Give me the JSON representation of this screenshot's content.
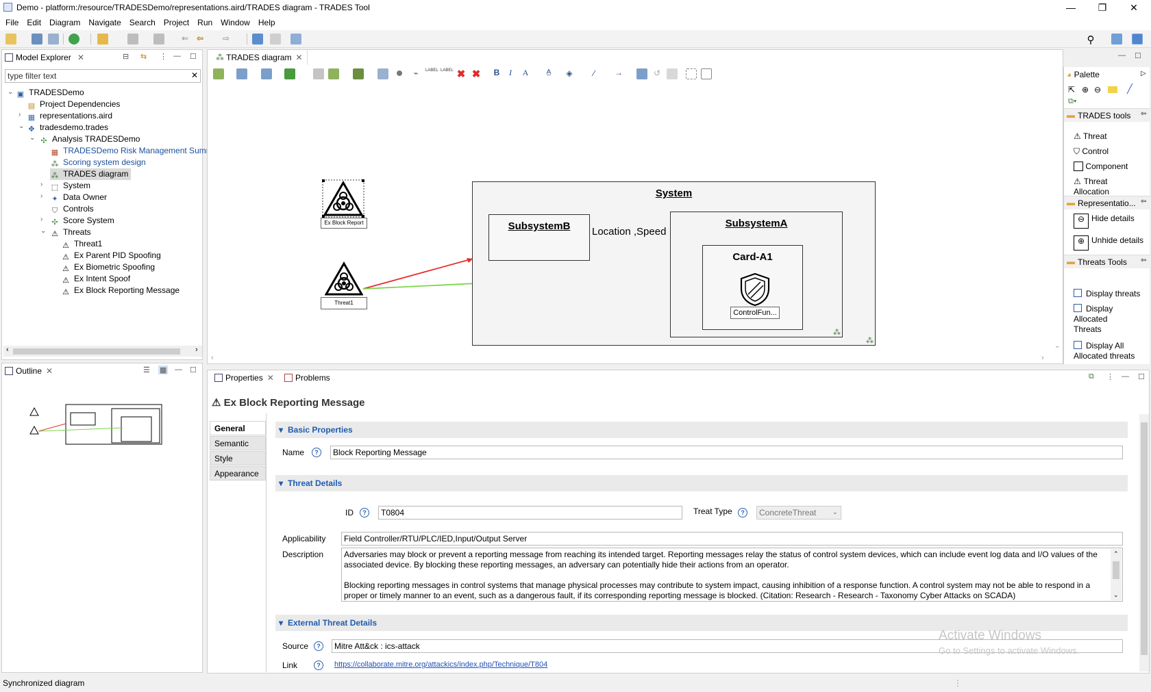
{
  "window": {
    "title": "Demo - platform:/resource/TRADESDemo/representations.aird/TRADES diagram - TRADES Tool"
  },
  "menu": [
    "File",
    "Edit",
    "Diagram",
    "Navigate",
    "Search",
    "Project",
    "Run",
    "Window",
    "Help"
  ],
  "model_explorer": {
    "tab": "Model Explorer",
    "filter_placeholder": "type filter text",
    "tree": [
      {
        "label": "TRADESDemo",
        "icon": "project-icon"
      },
      {
        "label": "Project Dependencies",
        "icon": "dependencies-icon"
      },
      {
        "label": "representations.aird",
        "icon": "aird-file-icon"
      },
      {
        "label": "tradesdemo.trades",
        "icon": "trades-file-icon"
      },
      {
        "label": "Analysis TRADESDemo",
        "icon": "analysis-icon"
      },
      {
        "label": "TRADESDemo Risk Management Sumr",
        "icon": "table-icon"
      },
      {
        "label": "Scoring system design",
        "icon": "diagram-icon"
      },
      {
        "label": "TRADES diagram",
        "icon": "diagram-icon"
      },
      {
        "label": "System",
        "icon": "system-icon"
      },
      {
        "label": "Data Owner",
        "icon": "data-owner-icon"
      },
      {
        "label": "Controls",
        "icon": "control-icon"
      },
      {
        "label": "Score System",
        "icon": "score-icon"
      },
      {
        "label": "Threats",
        "icon": "threat-icon"
      },
      {
        "label": "Threat1",
        "icon": "threat-icon"
      },
      {
        "label": "Ex Parent PID Spoofing",
        "icon": "threat-icon"
      },
      {
        "label": "Ex Biometric Spoofing",
        "icon": "threat-icon"
      },
      {
        "label": "Ex Intent Spoof",
        "icon": "threat-icon"
      },
      {
        "label": "Ex Block Reporting Message",
        "icon": "threat-icon"
      }
    ]
  },
  "outline": {
    "tab": "Outline"
  },
  "editor": {
    "tab": "TRADES diagram",
    "diagram": {
      "system": "System",
      "subsystem_b": "SubsystemB",
      "subsystem_a": "SubsystemA",
      "card": "Card-A1",
      "control_label": "ControlFun...",
      "edge_label": "Location ,Speed",
      "threat1_label": "Threat1",
      "threat_block_label": "Ex Block Report"
    }
  },
  "palette": {
    "title": "Palette",
    "sections": [
      {
        "title": "TRADES tools",
        "items": [
          "Threat",
          "Control",
          "Component",
          "Threat Allocation"
        ]
      },
      {
        "title": "Representatio...",
        "items": [
          "Hide details",
          "Unhide details"
        ]
      },
      {
        "title": "Threats Tools",
        "items": [
          "Display threats",
          "Display Allocated Threats",
          "Display All Allocated threats"
        ]
      }
    ]
  },
  "properties": {
    "tabs": [
      "Properties",
      "Problems"
    ],
    "header": "Ex Block Reporting Message",
    "side_tabs": [
      "General",
      "Semantic",
      "Style",
      "Appearance"
    ],
    "basic": {
      "section": "Basic Properties",
      "name_label": "Name",
      "name_value": "Block Reporting Message"
    },
    "threat": {
      "section": "Threat Details",
      "id_label": "ID",
      "id_value": "T0804",
      "type_label": "Treat Type",
      "type_value": "ConcreteThreat",
      "applicability_label": "Applicability",
      "applicability_value": "Field Controller/RTU/PLC/IED,Input/Output Server",
      "description_label": "Description",
      "description_p1": "Adversaries may block or prevent a reporting message from reaching its intended target. Reporting messages relay the status of control system devices, which can include event log data and I/O values of the associated device. By blocking these reporting messages, an adversary can potentially hide their actions from an operator.",
      "description_p2": "Blocking reporting messages in control systems that manage physical processes may contribute to system impact, causing inhibition of a response function. A control system may not be able to respond in a proper or timely manner to an event, such as a dangerous fault, if its corresponding reporting message is blocked. (Citation: Research - Research - Taxonomy Cyber Attacks on SCADA)"
    },
    "external": {
      "section": "External Threat Details",
      "source_label": "Source",
      "source_value": "Mitre Att&ck : ics-attack",
      "link_label": "Link",
      "link_value": "https://collaborate.mitre.org/attackics/index.php/Technique/T804"
    }
  },
  "watermark": {
    "line1": "Activate Windows",
    "line2": "Go to Settings to activate Windows."
  },
  "status": "Synchronized diagram",
  "colors": {
    "threat_edge": "#e82a2a",
    "allocation_edge": "#7ad64a",
    "section_blue": "#1f5bb1"
  }
}
